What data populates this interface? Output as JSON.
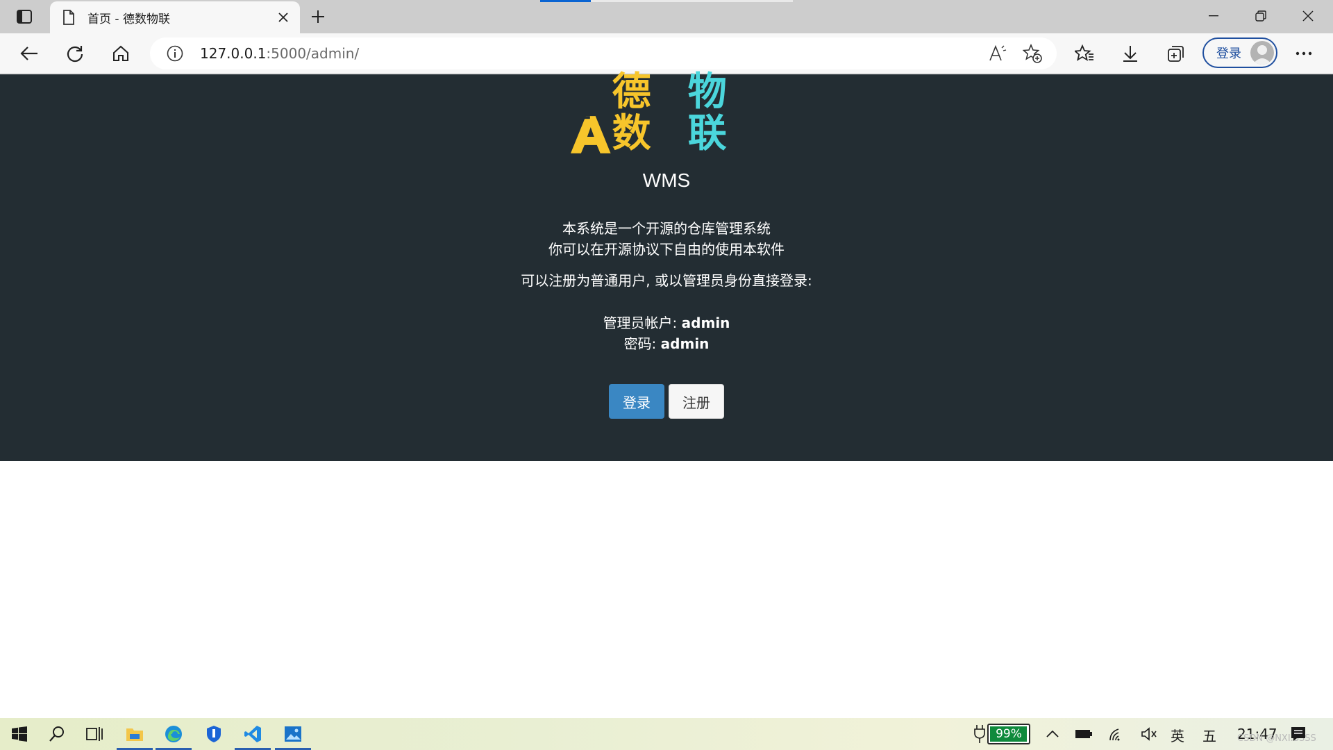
{
  "browser": {
    "tab": {
      "title": "首页 - 德数物联"
    },
    "address": {
      "host": "127.0.0.1",
      "path": ":5000/admin/"
    },
    "profile": {
      "signin_label": "登录"
    },
    "load_progress": 0.2,
    "accent_color": "#1f4f9f"
  },
  "page": {
    "logo": {
      "mark_text": "A",
      "text_yellow": "德数",
      "text_cyan": "物联"
    },
    "subtitle": "WMS",
    "desc_line1": "本系统是一个开源的仓库管理系统",
    "desc_line2": "你可以在开源协议下自由的使用本软件",
    "desc_line3": "可以注册为普通用户, 或以管理员身份直接登录:",
    "account_label": "管理员帐户: ",
    "account_value": "admin",
    "password_label": "密码: ",
    "password_value": "admin",
    "login_button": "登录",
    "register_button": "注册",
    "colors": {
      "background": "#232d33",
      "primary": "#3a87c3",
      "logo_yellow": "#f7c52b",
      "logo_cyan": "#4bd6dc"
    }
  },
  "taskbar": {
    "battery_percent": "99%",
    "battery_level": 0.99,
    "ime_lang": "英",
    "ime_mode": "五",
    "clock": "21:47",
    "watermark": "CSDN @NXI.SSSS"
  }
}
